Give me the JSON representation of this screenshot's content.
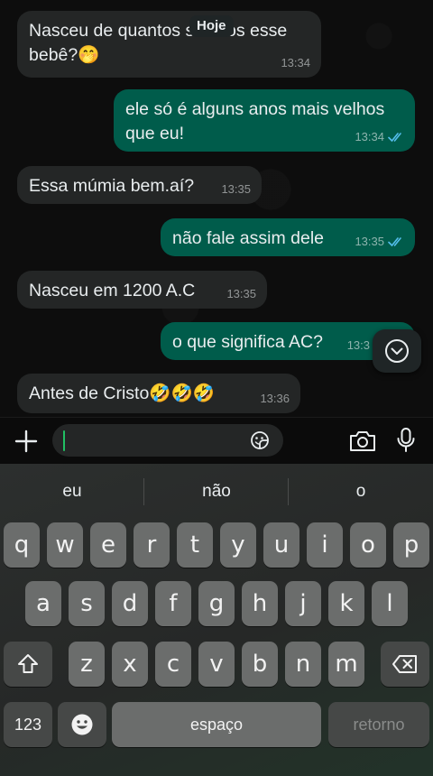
{
  "chat": {
    "date_label": "Hoje",
    "messages": [
      {
        "text_line1": "Nasceu de quantos séculos esse",
        "text_line2": "bebê?🤭",
        "time": "13:34"
      },
      {
        "text_line1": "ele só é alguns anos mais velhos",
        "text_line2": "que eu!",
        "time": "13:34"
      },
      {
        "text": "Essa múmia bem.aí?",
        "time": "13:35"
      },
      {
        "text": "não fale assim dele",
        "time": "13:35"
      },
      {
        "text": "Nasceu em 1200 A.C",
        "time": "13:35"
      },
      {
        "text": "o que significa AC?",
        "time": "13:3"
      },
      {
        "text": "Antes de Cristo🤣🤣🤣",
        "time": "13:36"
      }
    ]
  },
  "composer": {
    "input_value": "",
    "icons": [
      "plus-icon",
      "sticker-icon",
      "camera-icon",
      "microphone-icon"
    ]
  },
  "keyboard": {
    "suggestions": [
      "eu",
      "não",
      "o"
    ],
    "row1": [
      "q",
      "w",
      "e",
      "r",
      "t",
      "y",
      "u",
      "i",
      "o",
      "p"
    ],
    "row2": [
      "a",
      "s",
      "d",
      "f",
      "g",
      "h",
      "j",
      "k",
      "l"
    ],
    "row3": [
      "z",
      "x",
      "c",
      "v",
      "b",
      "n",
      "m"
    ],
    "numbers_label": "123",
    "space_label": "espaço",
    "return_label": "retorno"
  },
  "colors": {
    "incoming_bubble": "#242626",
    "outgoing_bubble": "#005c4b",
    "read_ticks": "#53bdeb",
    "caret": "#21c063"
  }
}
